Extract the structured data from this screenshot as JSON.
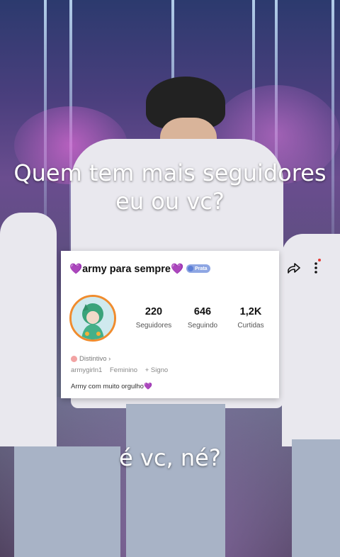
{
  "captions": {
    "top": "Quem tem mais seguidores eu ou vc?",
    "bottom": "é vc, né?"
  },
  "profile": {
    "username": "army para sempre",
    "badge_label": "Prata",
    "stats": [
      {
        "value": "220",
        "label": "Seguidores"
      },
      {
        "value": "646",
        "label": "Seguindo"
      },
      {
        "value": "1,2K",
        "label": "Curtidas"
      }
    ],
    "distintivo_label": "Distintivo ›",
    "handle": "armygirln1",
    "gender": "Feminino",
    "add_sign": "+ Signo",
    "bio_text": "Army com muito orgulho",
    "heart_glyph": "💜"
  },
  "icons": {
    "share": "share-arrow-icon",
    "more": "more-vertical-icon",
    "heart_color": "#9b3bd6",
    "avatar_ring_color": "#f08c2e"
  }
}
